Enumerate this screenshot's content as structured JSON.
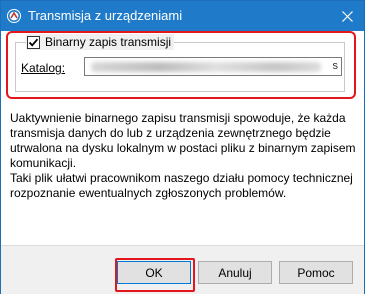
{
  "window": {
    "title": "Transmisja z urządzeniami",
    "icons": {
      "app": "app-logo-icon",
      "close": "close-icon"
    }
  },
  "group": {
    "checkbox_label": "Binarny zapis transmisji",
    "checked": true,
    "catalog_label": "Katalog:",
    "catalog_value_hidden": true,
    "browse_glyph": "s"
  },
  "description": {
    "paragraph1": "Uaktywnienie binarnego zapisu transmisji spowoduje, że każda transmisja danych do lub z urządzenia zewnętrznego będzie utrwalona na dysku lokalnym w postaci pliku z binarnym zapisem komunikacji.",
    "paragraph2": "Taki plik ułatwi pracownikom naszego działu pomocy technicznej rozpoznanie ewentualnych zgłoszonych problemów."
  },
  "buttons": {
    "ok": "OK",
    "cancel": "Anuluj",
    "help": "Pomoc"
  },
  "colors": {
    "titlebar": "#1f7bc9",
    "highlight": "#e3161c",
    "focus_border": "#0078d7"
  }
}
